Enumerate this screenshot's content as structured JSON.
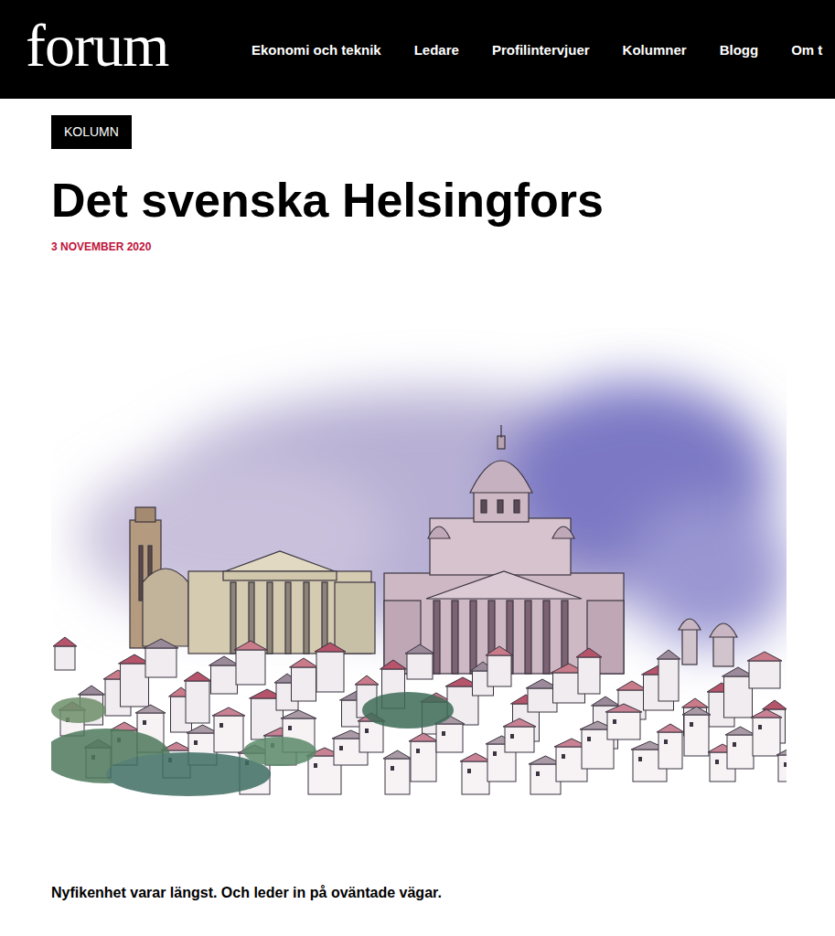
{
  "header": {
    "logo": "forum",
    "nav": [
      {
        "label": "Ekonomi och teknik"
      },
      {
        "label": "Ledare"
      },
      {
        "label": "Profilintervjuer"
      },
      {
        "label": "Kolumner"
      },
      {
        "label": "Blogg"
      },
      {
        "label": "Om t"
      }
    ]
  },
  "article": {
    "badge": "KOLUMN",
    "title": "Det svenska Helsingfors",
    "date": "3 NOVEMBER 2020",
    "lead": "Nyfikenhet varar längst. Och leder in på oväntade vägar."
  }
}
